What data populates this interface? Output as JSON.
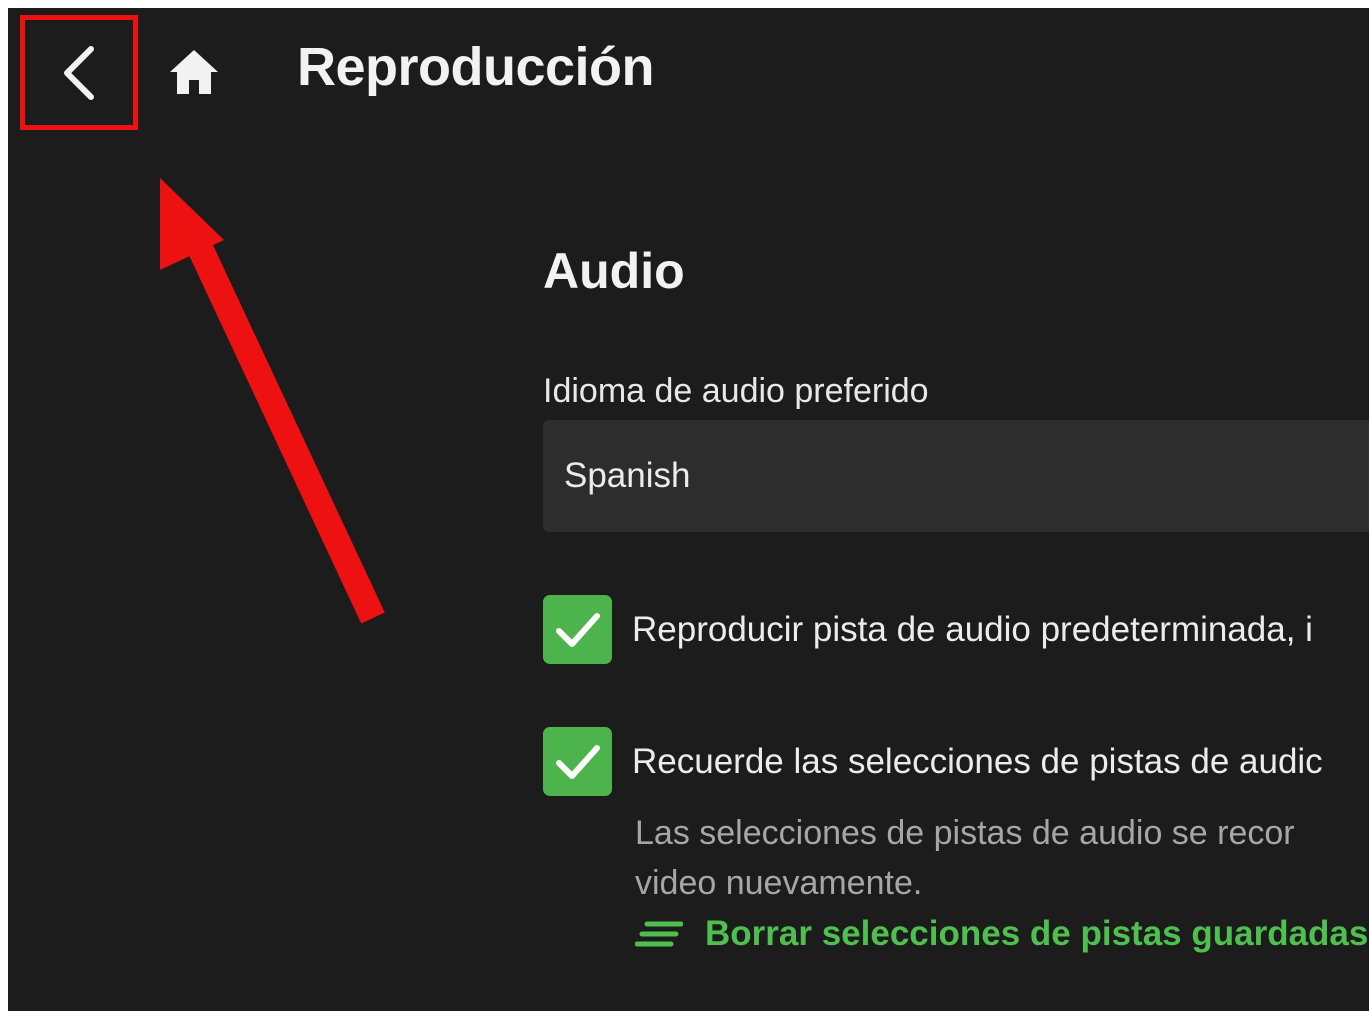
{
  "header": {
    "back_icon": "chevron-left-icon",
    "home_icon": "home-icon",
    "title": "Reproducción"
  },
  "audio": {
    "section_title": "Audio",
    "preferred_language_label": "Idioma de audio preferido",
    "preferred_language_value": "Spanish",
    "option_default_track": {
      "label": "Reproducir pista de audio predeterminada, i",
      "checked": true
    },
    "option_remember_selection": {
      "label": "Recuerde las selecciones de pistas de audic",
      "checked": true,
      "help_line_1": "Las selecciones de pistas de audio se recor",
      "help_line_2": "video nuevamente."
    },
    "clear_link": {
      "icon": "clear-list-icon",
      "label": "Borrar selecciones de pistas guardadas"
    }
  },
  "colors": {
    "background": "#1c1c1c",
    "accent": "#4db34d",
    "annotation": "#ee1111"
  }
}
